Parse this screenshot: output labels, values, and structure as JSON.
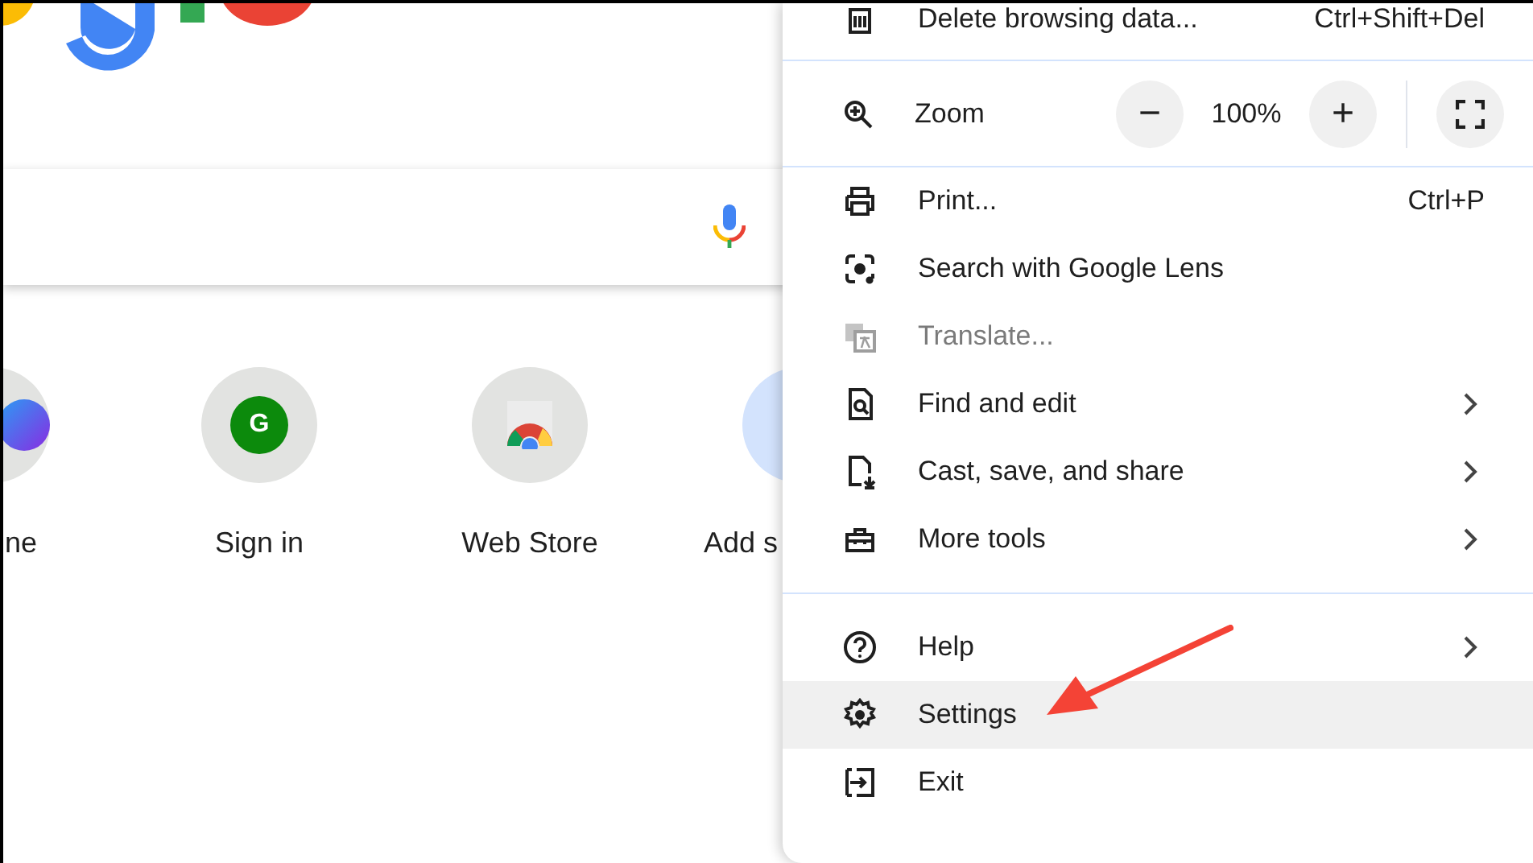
{
  "page": {
    "shortcuts": [
      {
        "label": "ne"
      },
      {
        "label": "Sign in",
        "letter": "G"
      },
      {
        "label": "Web Store"
      },
      {
        "label": "Add s"
      }
    ]
  },
  "menu": {
    "items": [
      {
        "kind": "item",
        "label": "Delete browsing data...",
        "shortcut": "Ctrl+Shift+Del",
        "submenu": false,
        "disabled": false,
        "selected": false
      },
      {
        "kind": "divider"
      },
      {
        "kind": "zoom",
        "label": "Zoom",
        "minus": "−",
        "value": "100%",
        "plus": "+"
      },
      {
        "kind": "divider"
      },
      {
        "kind": "item",
        "label": "Print...",
        "shortcut": "Ctrl+P",
        "submenu": false,
        "disabled": false,
        "selected": false
      },
      {
        "kind": "item",
        "label": "Search with Google Lens",
        "submenu": false,
        "disabled": false,
        "selected": false
      },
      {
        "kind": "item",
        "label": "Translate...",
        "submenu": false,
        "disabled": true,
        "selected": false
      },
      {
        "kind": "item",
        "label": "Find and edit",
        "submenu": true,
        "disabled": false,
        "selected": false
      },
      {
        "kind": "item",
        "label": "Cast, save, and share",
        "submenu": true,
        "disabled": false,
        "selected": false
      },
      {
        "kind": "item",
        "label": "More tools",
        "submenu": true,
        "disabled": false,
        "selected": false
      },
      {
        "kind": "divider"
      },
      {
        "kind": "item",
        "label": "Help",
        "submenu": true,
        "disabled": false,
        "selected": false
      },
      {
        "kind": "item",
        "label": "Settings",
        "submenu": false,
        "disabled": false,
        "selected": true
      },
      {
        "kind": "item",
        "label": "Exit",
        "submenu": false,
        "disabled": false,
        "selected": false
      }
    ]
  }
}
